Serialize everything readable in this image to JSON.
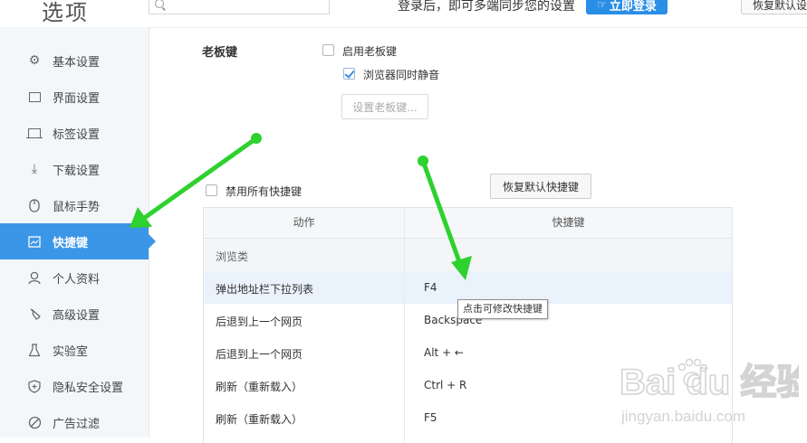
{
  "header": {
    "title": "选项",
    "search_placeholder": "",
    "login_hint": "登录后，即可多端同步您的设置",
    "login_button": "立即登录",
    "restore_defaults": "恢复默认设置"
  },
  "sidebar": {
    "items": [
      {
        "label": "基本设置",
        "icon": "gear-icon"
      },
      {
        "label": "界面设置",
        "icon": "window-icon"
      },
      {
        "label": "标签设置",
        "icon": "tab-icon"
      },
      {
        "label": "下载设置",
        "icon": "download-icon"
      },
      {
        "label": "鼠标手势",
        "icon": "mouse-icon"
      },
      {
        "label": "快捷键",
        "icon": "keyboard-icon",
        "active": true
      },
      {
        "label": "个人资料",
        "icon": "user-icon"
      },
      {
        "label": "高级设置",
        "icon": "wrench-icon"
      },
      {
        "label": "实验室",
        "icon": "flask-icon"
      },
      {
        "label": "隐私安全设置",
        "icon": "shield-icon"
      },
      {
        "label": "广告过滤",
        "icon": "block-icon"
      }
    ]
  },
  "boss_key": {
    "label": "老板键",
    "enable_label": "启用老板键",
    "enable_checked": false,
    "mute_label": "浏览器同时静音",
    "mute_checked": true,
    "set_button": "设置老板键..."
  },
  "shortcuts": {
    "disable_all_label": "禁用所有快捷键",
    "disable_all_checked": false,
    "restore_button": "恢复默认快捷键",
    "columns": [
      "动作",
      "快捷键"
    ],
    "group": "浏览类",
    "rows": [
      {
        "action": "弹出地址栏下拉列表",
        "key": "F4"
      },
      {
        "action": "后退到上一个网页",
        "key": "Backspace"
      },
      {
        "action": "后退到上一个网页",
        "key": "Alt + ←"
      },
      {
        "action": "刷新（重新载入）",
        "key": "Ctrl + R"
      },
      {
        "action": "刷新（重新载入）",
        "key": "F5"
      }
    ],
    "tooltip": "点击可修改快捷键"
  },
  "watermark": {
    "brand": "Bai du 经验",
    "url": "jingyan.baidu.com"
  },
  "colors": {
    "accent": "#3b96e8",
    "annotation_arrow": "#2ed12e"
  }
}
